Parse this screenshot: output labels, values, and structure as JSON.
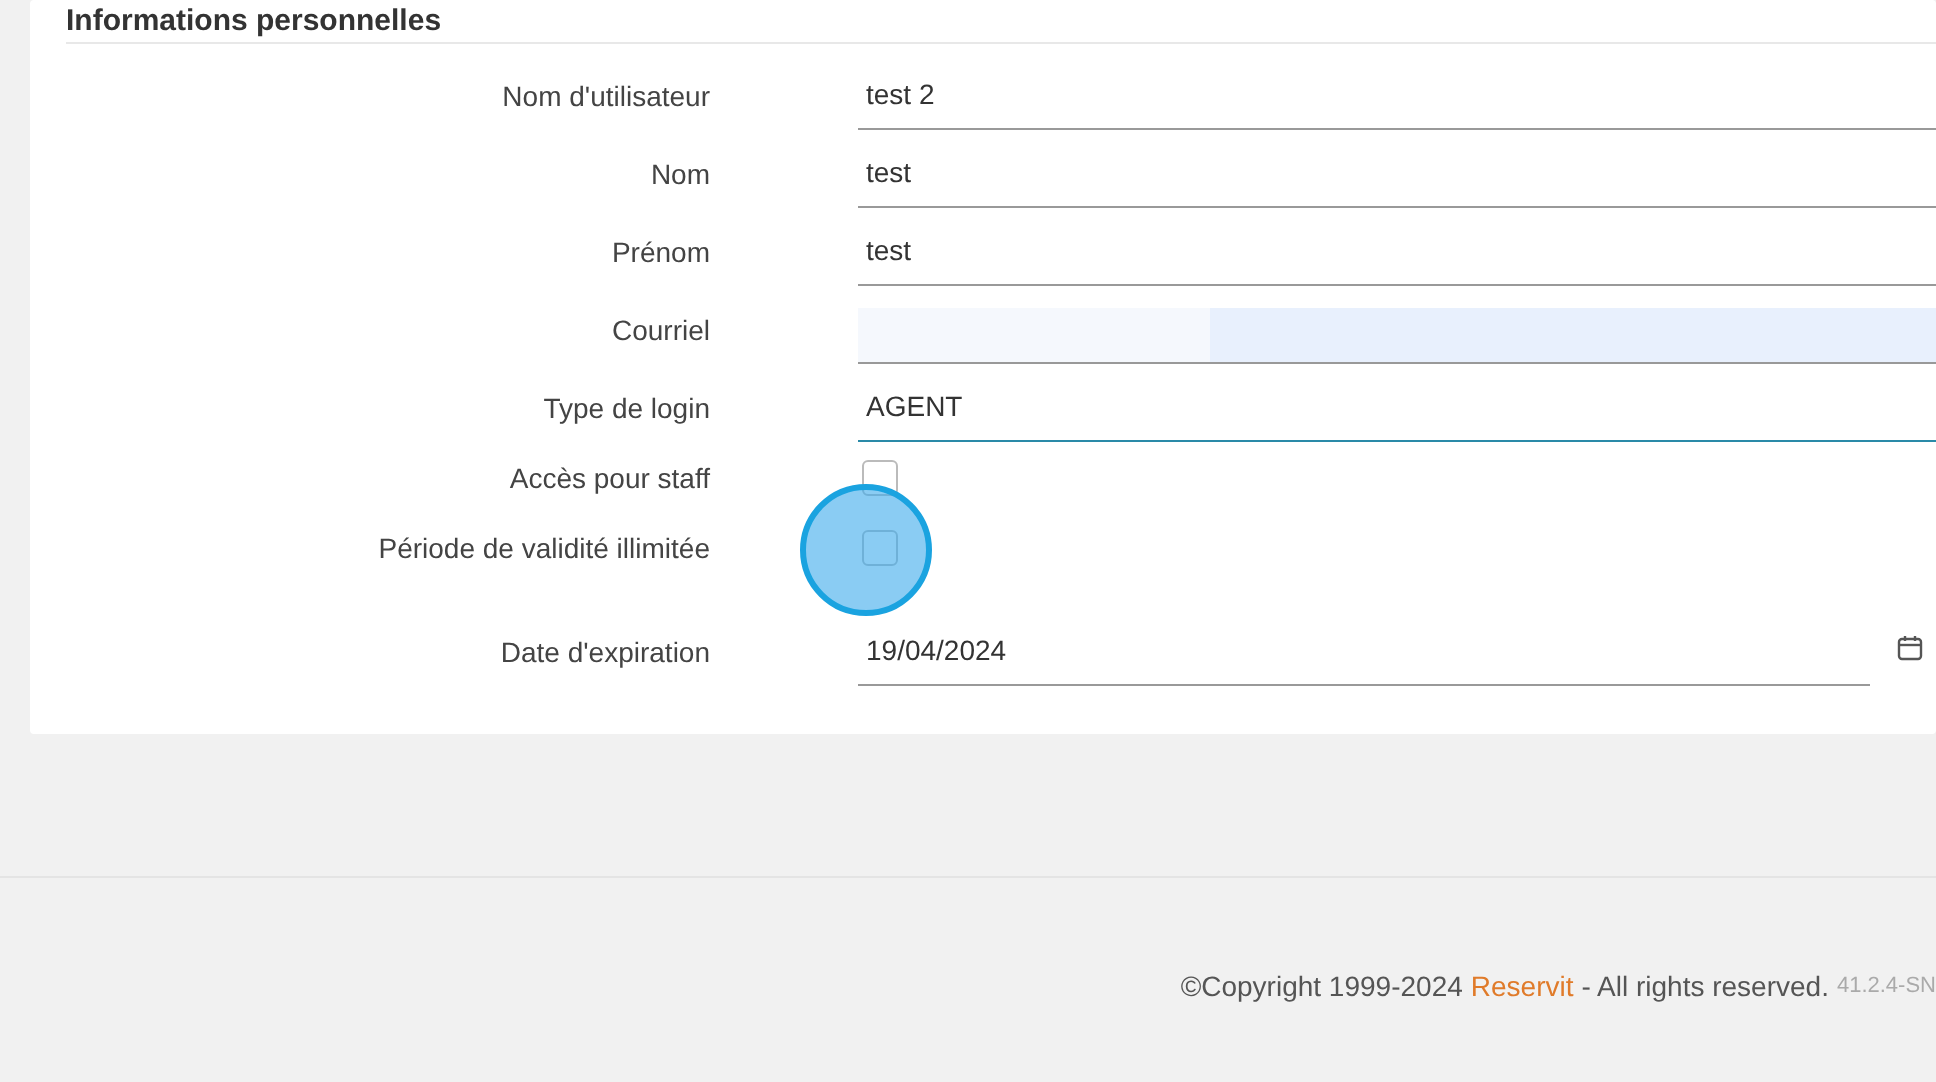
{
  "section": {
    "title": "Informations personnelles"
  },
  "fields": [
    {
      "kind": "text",
      "label": "Nom d'utilisateur",
      "value": "test 2",
      "focused": false,
      "autofilled": false
    },
    {
      "kind": "text",
      "label": "Nom",
      "value": "test",
      "focused": false,
      "autofilled": false
    },
    {
      "kind": "text",
      "label": "Prénom",
      "value": "test",
      "focused": false,
      "autofilled": false
    },
    {
      "kind": "text",
      "label": "Courriel",
      "focused": false,
      "autofilled": true
    },
    {
      "kind": "text",
      "label": "Type de login",
      "value": "AGENT",
      "focused": true,
      "autofilled": false
    },
    {
      "kind": "checkbox",
      "label": "Accès pour staff",
      "checked": false
    },
    {
      "kind": "checkbox",
      "label": "Période de validité illimitée",
      "checked": false,
      "clicked": true
    },
    {
      "kind": "date",
      "label": "Date d'expiration",
      "value": "19/04/2024"
    }
  ],
  "footer": {
    "copyright": "©Copyright 1999-2024",
    "brand_link": "Reservit",
    "rights": "- All rights reserved.",
    "version": "41.2.4-SN"
  }
}
